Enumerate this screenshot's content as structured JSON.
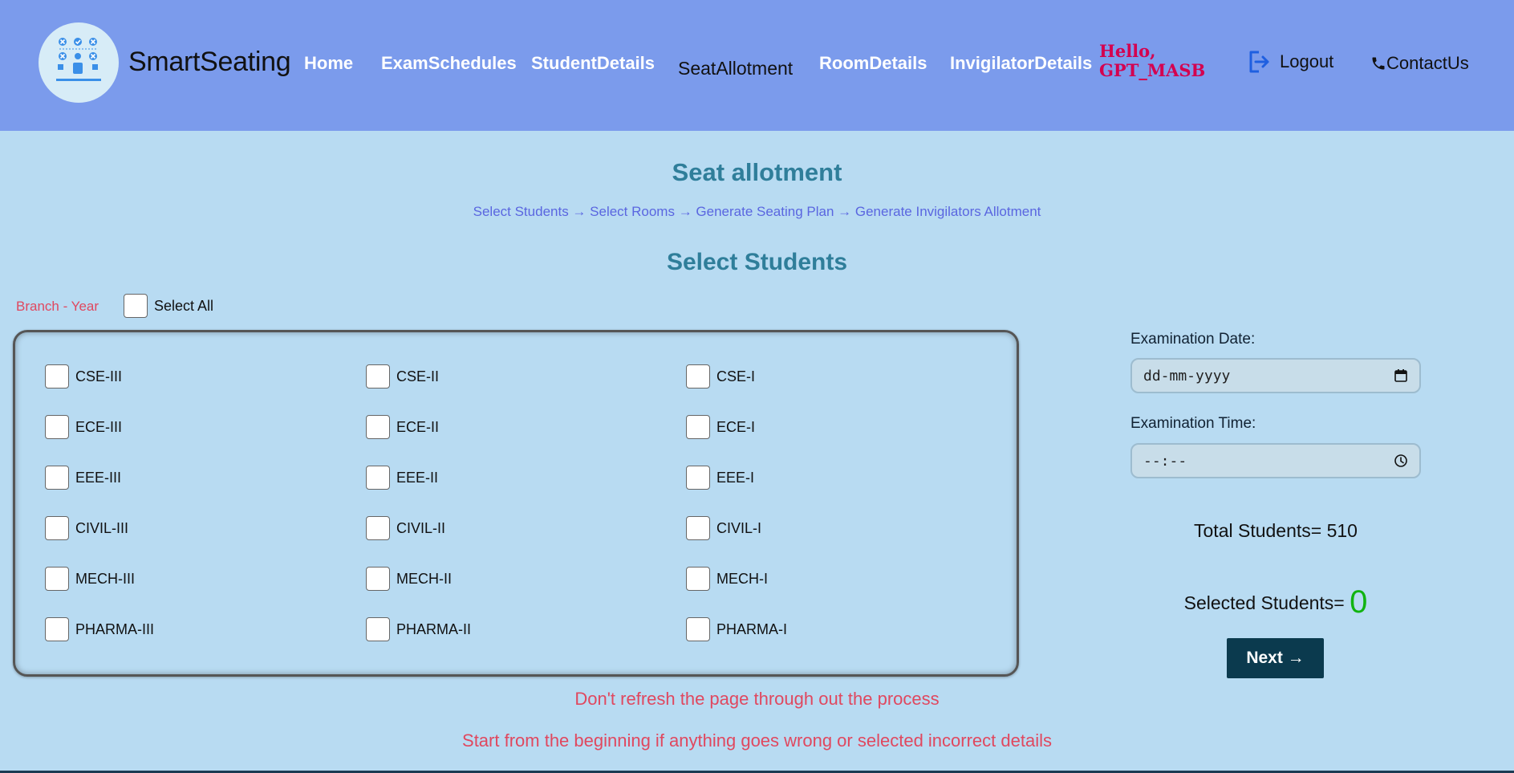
{
  "header": {
    "brand": "SmartSeating",
    "nav": [
      "Home",
      "ExamSchedules",
      "StudentDetails",
      "SeatAllotment",
      "RoomDetails",
      "InvigilatorDetails"
    ],
    "active_nav": "SeatAllotment",
    "greeting_line1": "Hello,",
    "greeting_line2": "GPT_MASB",
    "logout": "Logout",
    "contact": "ContactUs"
  },
  "page": {
    "title": "Seat allotment",
    "steps": "Select Students → Select Rooms → Generate Seating Plan → Generate Invigilators Allotment",
    "section_title": "Select Students",
    "branch_year_label": "Branch - Year",
    "select_all": "Select All"
  },
  "options": [
    [
      "CSE-III",
      "CSE-II",
      "CSE-I"
    ],
    [
      "ECE-III",
      "ECE-II",
      "ECE-I"
    ],
    [
      "EEE-III",
      "EEE-II",
      "EEE-I"
    ],
    [
      "CIVIL-III",
      "CIVIL-II",
      "CIVIL-I"
    ],
    [
      "MECH-III",
      "MECH-II",
      "MECH-I"
    ],
    [
      "PHARMA-III",
      "PHARMA-II",
      "PHARMA-I"
    ]
  ],
  "form": {
    "date_label": "Examination Date:",
    "date_placeholder": "dd-mm-yyyy",
    "time_label": "Examination Time:",
    "time_placeholder": "--:--",
    "total_students": "Total Students= 510",
    "selected_label": "Selected Students=",
    "selected_count": "0",
    "next_button": "Next →"
  },
  "warnings": {
    "line1": "Don't refresh the page through out the process",
    "line2": "Start from the beginning if anything goes wrong or selected incorrect details"
  },
  "colors": {
    "header_bg": "#7b9bec",
    "page_bg": "#b8dbf2",
    "title": "#2f7e9a",
    "steps": "#5a66e0",
    "warning": "#e0485f",
    "greeting": "#d4004f",
    "selected_count": "#11b311",
    "button_bg": "#0b3a4e"
  },
  "icons": [
    "smartseating-logo-icon",
    "logout-icon",
    "phone-icon",
    "calendar-icon",
    "clock-icon"
  ]
}
